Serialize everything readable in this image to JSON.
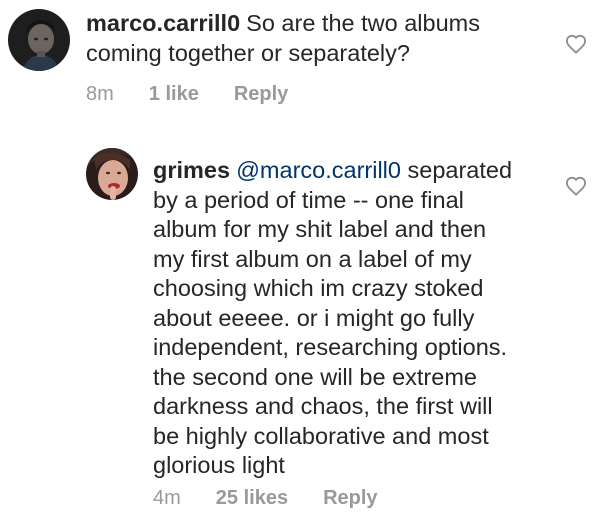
{
  "comments": [
    {
      "username": "marco.carrill0",
      "lines_rest": [
        "So are the two albums",
        "coming together or separately?"
      ],
      "time": "8m",
      "likes": "1 like",
      "reply_label": "Reply",
      "avatar_icon": "avatar-marco-icon",
      "like_icon": "heart-outline-icon"
    },
    {
      "username": "grimes",
      "mention": "@marco.carrill0",
      "first_line_rest": "separated",
      "lines_rest": [
        "by a period of time -- one final",
        "album for my shit label and then",
        "my first album on a label of my",
        "choosing which im crazy stoked",
        "about eeeee.  or i might go fully",
        "independent, researching options.",
        "the second one will be extreme",
        "darkness and chaos, the first will",
        "be highly collaborative and most",
        "glorious light"
      ],
      "time": "4m",
      "likes": "25 likes",
      "reply_label": "Reply",
      "avatar_icon": "avatar-grimes-icon",
      "like_icon": "heart-outline-icon"
    }
  ],
  "colors": {
    "text": "#262626",
    "meta": "#999999",
    "mention": "#003569",
    "heart_stroke": "#8e8e8e"
  }
}
